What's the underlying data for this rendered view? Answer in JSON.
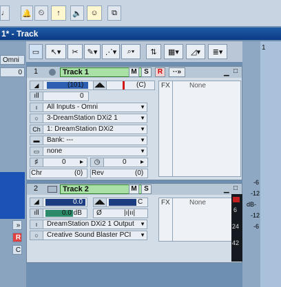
{
  "toolbar": {
    "note_icon": "♩",
    "tools": [
      "note-bells",
      "metronome",
      "arrow-up",
      "speaker",
      "smiley",
      "copy"
    ]
  },
  "window": {
    "title": "1* - Track"
  },
  "left_pane": {
    "omni": "Omni",
    "zero": "0",
    "reset": "R",
    "c": "C",
    "arrow": "»"
  },
  "strip": {
    "tools": [
      "select",
      "arrow",
      "scissors",
      "draw",
      "smart",
      "zoom",
      "snap",
      "grid",
      "vol",
      "list"
    ]
  },
  "track1": {
    "number": "1",
    "name": "Track 1",
    "m": "M",
    "s": "S",
    "r": "R",
    "arrows": "··»",
    "volume": "(101)",
    "pan": "(C)",
    "trim": "0",
    "input": "All Inputs - Omni",
    "output": "3-DreamStation DXi2 1",
    "channel_label": "Ch",
    "channel": "1: DreamStation DXi2",
    "bank": "Bank: ---",
    "patch": "none",
    "key_value": "0",
    "shift_value": "0",
    "chorus_label": "Chr",
    "chorus_value": "(0)",
    "reverb_label": "Rev",
    "reverb_value": "(0)",
    "fx_label": "FX",
    "fx_none": "None"
  },
  "track2": {
    "number": "2",
    "name": "Track 2",
    "m": "M",
    "s": "S",
    "volume": "0.0",
    "pan": "C",
    "trim": "0.0 dB",
    "phase": "Ø",
    "output": "DreamStation DXi2 1 Output",
    "input": "Creative Sound Blaster PCI",
    "fx_label": "FX",
    "fx_none": "None"
  },
  "meter": {
    "labels": [
      "-6",
      "-12",
      "dB-",
      "-12",
      "-6"
    ],
    "ticks": [
      "6",
      "24",
      "42"
    ]
  }
}
